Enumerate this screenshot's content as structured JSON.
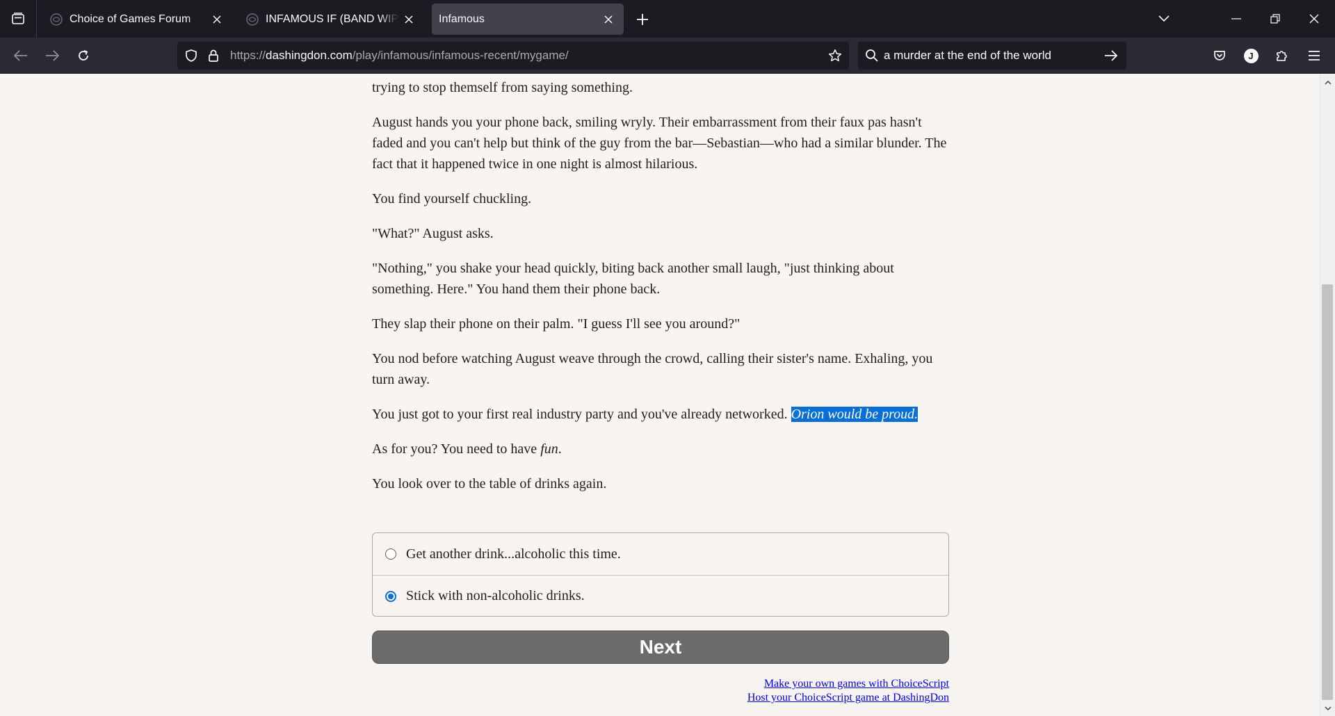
{
  "browser": {
    "tabs": [
      {
        "title": "Choice of Games Forum",
        "active": false
      },
      {
        "title": "INFAMOUS IF (BAND WIP) CHARACTER",
        "active": false
      },
      {
        "title": "Infamous",
        "active": true
      }
    ],
    "url": {
      "prefix": "https://",
      "host": "dashingdon.com",
      "path": "/play/infamous/infamous-recent/mygame/"
    },
    "search_value": "a murder at the end of the world",
    "account_initial": "J"
  },
  "story": {
    "paragraphs": [
      "avoids your gaze throughout the whole ordeal, though they still have their lips pinched as if they're trying to stop themself from saying something.",
      "August hands you your phone back, smiling wryly. Their embarrassment from their faux pas hasn't faded and you can't help but think of the guy from the bar—Sebastian—who had a similar blunder. The fact that it happened twice in one night is almost hilarious.",
      "You find yourself chuckling.",
      "\"What?\" August asks.",
      "\"Nothing,\" you shake your head quickly, biting back another small laugh, \"just thinking about something. Here.\" You hand them their phone back.",
      "They slap their phone on their palm. \"I guess I'll see you around?\"",
      "You nod before watching August weave through the crowd, calling their sister's name. Exhaling, you turn away."
    ],
    "networked_text": "You just got to your first real industry party and you've already networked. ",
    "networked_highlight": "Orion would be proud.",
    "fun_prefix": "As for you? You need to have ",
    "fun_em": "fun",
    "fun_suffix": ".",
    "last_paragraph": "You look over to the table of drinks again."
  },
  "choices": [
    {
      "label": "Get another drink...alcoholic this time.",
      "selected": false
    },
    {
      "label": "Stick with non-alcoholic drinks.",
      "selected": true
    }
  ],
  "next_label": "Next",
  "footer": {
    "link1": "Make your own games with ChoiceScript",
    "link2": "Host your ChoiceScript game at DashingDon"
  },
  "colors": {
    "highlight": "#0a6fd4",
    "page_bg": "#f7f4f1",
    "next_bg": "#6b6b6b"
  }
}
